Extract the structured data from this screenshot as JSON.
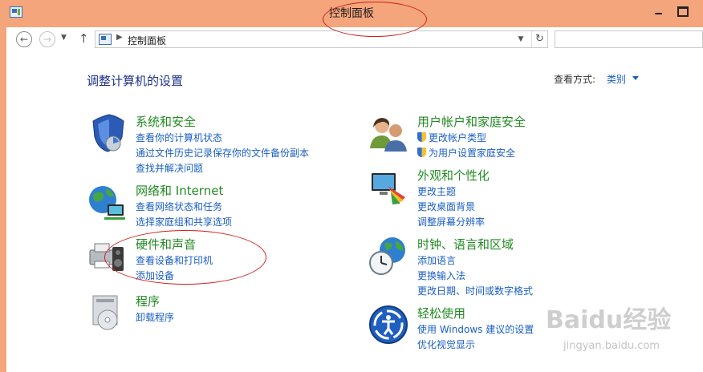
{
  "window": {
    "title": "控制面板"
  },
  "address_bar": {
    "path": "控制面板"
  },
  "heading": "调整计算机的设置",
  "view_by": {
    "label": "查看方式:",
    "value": "类别"
  },
  "categories": [
    {
      "title": "系统和安全",
      "icon": "shield-icon",
      "links": [
        {
          "text": "查看你的计算机状态"
        },
        {
          "text": "通过文件历史记录保存你的文件备份副本"
        },
        {
          "text": "查找并解决问题"
        }
      ]
    },
    {
      "title": "网络和 Internet",
      "icon": "network-globe-icon",
      "links": [
        {
          "text": "查看网络状态和任务"
        },
        {
          "text": "选择家庭组和共享选项"
        }
      ]
    },
    {
      "title": "硬件和声音",
      "icon": "printer-speaker-icon",
      "links": [
        {
          "text": "查看设备和打印机"
        },
        {
          "text": "添加设备"
        }
      ]
    },
    {
      "title": "程序",
      "icon": "programs-icon",
      "links": [
        {
          "text": "卸载程序"
        }
      ]
    },
    {
      "title": "用户帐户和家庭安全",
      "icon": "users-icon",
      "links": [
        {
          "text": "更改帐户类型",
          "shield": true
        },
        {
          "text": "为用户设置家庭安全",
          "shield": true
        }
      ]
    },
    {
      "title": "外观和个性化",
      "icon": "appearance-icon",
      "links": [
        {
          "text": "更改主题"
        },
        {
          "text": "更改桌面背景"
        },
        {
          "text": "调整屏幕分辨率"
        }
      ]
    },
    {
      "title": "时钟、语言和区域",
      "icon": "clock-globe-icon",
      "links": [
        {
          "text": "添加语言"
        },
        {
          "text": "更换输入法"
        },
        {
          "text": "更改日期、时间或数字格式"
        }
      ]
    },
    {
      "title": "轻松使用",
      "icon": "ease-of-access-icon",
      "links": [
        {
          "text": "使用 Windows 建议的设置"
        },
        {
          "text": "优化视觉显示"
        }
      ]
    }
  ],
  "watermark": {
    "logo": "Baidu经验",
    "url": "jingyan.baidu.com"
  },
  "colors": {
    "title_bar": "#f4a57c",
    "category_title": "#228b22",
    "link": "#1a5ec2",
    "heading": "#1e3287",
    "annotation": "#d21d1d"
  }
}
